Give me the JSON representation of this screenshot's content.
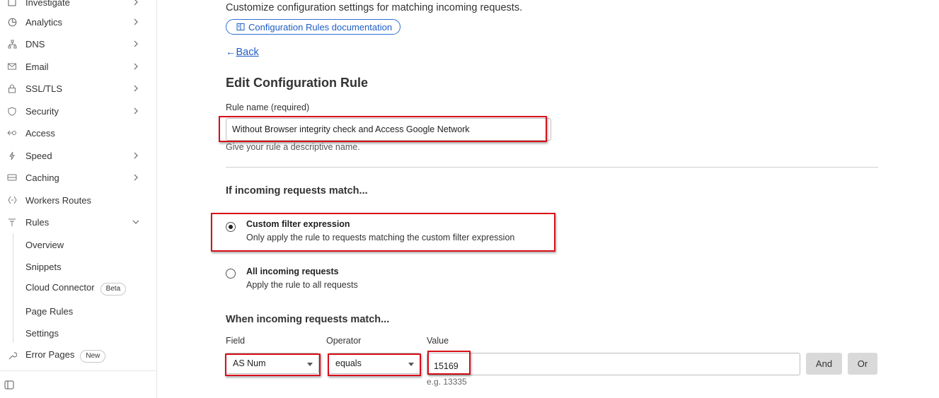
{
  "sidebar": {
    "items": [
      {
        "label": "Investigate",
        "icon": "investigate-icon"
      },
      {
        "label": "Analytics",
        "icon": "analytics-icon"
      },
      {
        "label": "DNS",
        "icon": "dns-icon"
      },
      {
        "label": "Email",
        "icon": "email-icon"
      },
      {
        "label": "SSL/TLS",
        "icon": "lock-icon"
      },
      {
        "label": "Security",
        "icon": "shield-icon"
      },
      {
        "label": "Access",
        "icon": "access-icon"
      },
      {
        "label": "Speed",
        "icon": "lightning-icon"
      },
      {
        "label": "Caching",
        "icon": "caching-icon"
      },
      {
        "label": "Workers Routes",
        "icon": "workers-icon"
      },
      {
        "label": "Rules",
        "icon": "rules-icon"
      }
    ],
    "rules_sub": [
      {
        "label": "Overview"
      },
      {
        "label": "Snippets"
      },
      {
        "label": "Cloud Connector",
        "badge": "Beta"
      },
      {
        "label": "Page Rules"
      },
      {
        "label": "Settings"
      }
    ],
    "error_pages": {
      "label": "Error Pages",
      "badge": "New"
    }
  },
  "main": {
    "description": "Customize configuration settings for matching incoming requests.",
    "doc_button": "Configuration Rules documentation",
    "back_arrow": "←",
    "back_label": "Back",
    "title": "Edit Configuration Rule",
    "rule_name_label": "Rule name (required)",
    "rule_name_value": "Without Browser integrity check and Access Google Network",
    "rule_name_hint": "Give your rule a descriptive name.",
    "if_heading": "If incoming requests match...",
    "options": [
      {
        "title": "Custom filter expression",
        "desc": "Only apply the rule to requests matching the custom filter expression",
        "selected": true
      },
      {
        "title": "All incoming requests",
        "desc": "Apply the rule to all requests",
        "selected": false
      }
    ],
    "when_heading": "When incoming requests match...",
    "field_label": "Field",
    "field_value": "AS Num",
    "operator_label": "Operator",
    "operator_value": "equals",
    "value_label": "Value",
    "value_value": "15169",
    "value_hint": "e.g. 13335",
    "and_button": "And",
    "or_button": "Or"
  },
  "colors": {
    "link": "#1f5cc4",
    "highlight": "#d8101a"
  }
}
